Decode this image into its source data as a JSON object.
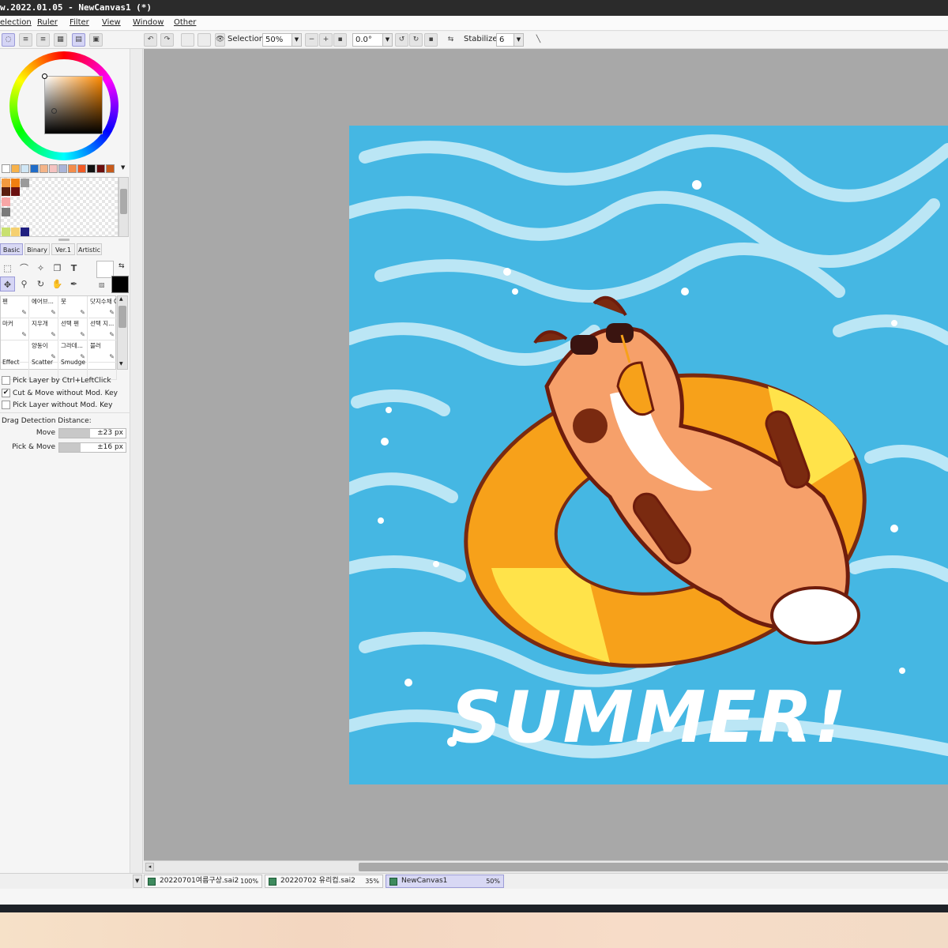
{
  "window": {
    "title": "w.2022.01.05 - NewCanvas1 (*)"
  },
  "menu": [
    "election",
    "Ruler",
    "Filter",
    "View",
    "Window",
    "Other"
  ],
  "toolbar": {
    "selection_label": "Selection",
    "zoom_value": "50%",
    "rotation_value": "0.0°",
    "stabilizer_label": "Stabilizer",
    "stabilizer_value": "6"
  },
  "palette": {
    "swatches": [
      "#ffffff",
      "#f7b24a",
      "#cfe6f5",
      "#1f6cc8",
      "#f4b488",
      "#f5c2c0",
      "#aab4d8",
      "#f48c4a",
      "#f15a24",
      "#111111",
      "#6b0e0e",
      "#c85a1a"
    ],
    "scratch": [
      "#f39a3f",
      "#f07f11",
      "#9a9a9a",
      "#5a1f0f",
      "#6a0f0f",
      "#f8a6a6",
      "#7a7a7a",
      "#c8e070",
      "#f5d070",
      "#202080"
    ]
  },
  "tool_tabs": [
    "Basic",
    "Binary",
    "Ver.1",
    "Artistic"
  ],
  "tools": {
    "foreground_color": "#000000",
    "background_color": "#ffffff"
  },
  "brushes": [
    {
      "label": "펜",
      "icon": "pen-icon"
    },
    {
      "label": "에어브...",
      "icon": "airbrush-icon"
    },
    {
      "label": "붓",
      "icon": "brush-icon"
    },
    {
      "label": "닷지수채 Color",
      "icon": "watercolor-icon"
    },
    {
      "label": "마커",
      "icon": "marker-icon"
    },
    {
      "label": "지우개",
      "icon": "eraser-icon"
    },
    {
      "label": "선택 펜",
      "icon": "select-pen-icon"
    },
    {
      "label": "선택 지...",
      "icon": "select-eraser-icon"
    },
    {
      "label": "",
      "icon": ""
    },
    {
      "label": "양동이",
      "icon": "bucket-icon"
    },
    {
      "label": "그라데...",
      "icon": "gradient-icon"
    },
    {
      "label": "블러",
      "icon": "blur-icon"
    },
    {
      "label": "Effect",
      "icon": ""
    },
    {
      "label": "Scatter",
      "icon": ""
    },
    {
      "label": "Smudge",
      "icon": ""
    },
    {
      "label": "",
      "icon": ""
    }
  ],
  "move_options": {
    "pick_ctrl_label": "Pick Layer by Ctrl+LeftClick",
    "pick_ctrl_checked": false,
    "cut_move_label": "Cut & Move without Mod. Key",
    "cut_move_checked": true,
    "pick_nomod_label": "Pick Layer without Mod. Key",
    "pick_nomod_checked": false,
    "drag_label": "Drag Detection Distance:",
    "move_label": "Move",
    "move_value": "±23 px",
    "move_fraction": 0.46,
    "pick_move_label": "Pick & Move",
    "pick_move_value": "±16 px",
    "pick_move_fraction": 0.32
  },
  "canvas": {
    "artwork_text": "SUMMER!",
    "water_color": "#45b7e3"
  },
  "doc_tabs": [
    {
      "name": "20220701여름구상.sai2",
      "zoom": "100%",
      "active": false
    },
    {
      "name": "20220702 유리컵.sai2",
      "zoom": "35%",
      "active": false
    },
    {
      "name": "NewCanvas1",
      "zoom": "50%",
      "active": true
    }
  ]
}
